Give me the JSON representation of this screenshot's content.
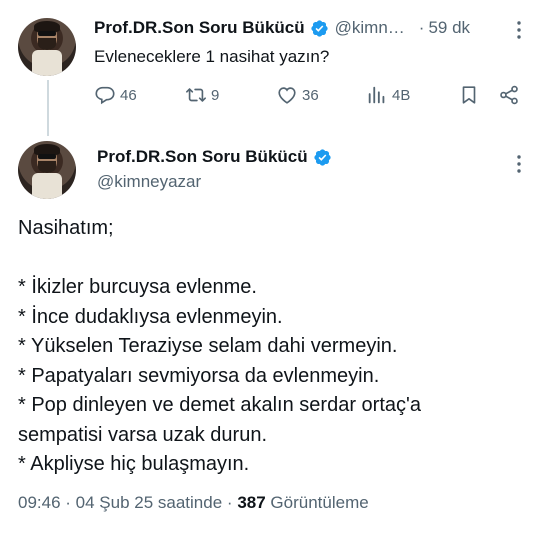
{
  "parent_tweet": {
    "display_name": "Prof.DR.Son Soru Bükücü",
    "handle": "@kimn…",
    "separator": "·",
    "time": "59 dk",
    "text": "Evleneceklere 1 nasihat yazın?",
    "stats": {
      "replies": "46",
      "retweets": "9",
      "likes": "36",
      "views": "4B"
    }
  },
  "reply_tweet": {
    "display_name": "Prof.DR.Son Soru Bükücü",
    "handle": "@kimneyazar",
    "lines": [
      "Nasihatım;",
      "",
      "* İkizler burcuysa evlenme.",
      "* İnce dudaklıysa evlenmeyin.",
      "* Yükselen Teraziyse selam dahi vermeyin.",
      "* Papatyaları sevmiyorsa da evlenmeyin.",
      "* Pop dinleyen ve demet akalın serdar ortaç'a",
      "sempatisi varsa uzak durun.",
      "* Akpliyse hiç bulaşmayın."
    ],
    "timestamp": "09:46 · 04 Şub 25 saatinde",
    "meta_separator": "·",
    "view_count": "387",
    "view_label": "Görüntüleme"
  },
  "colors": {
    "text": "#0f1419",
    "muted": "#536471",
    "verified": "#1d9bf0",
    "thread_line": "#cfd9de"
  }
}
